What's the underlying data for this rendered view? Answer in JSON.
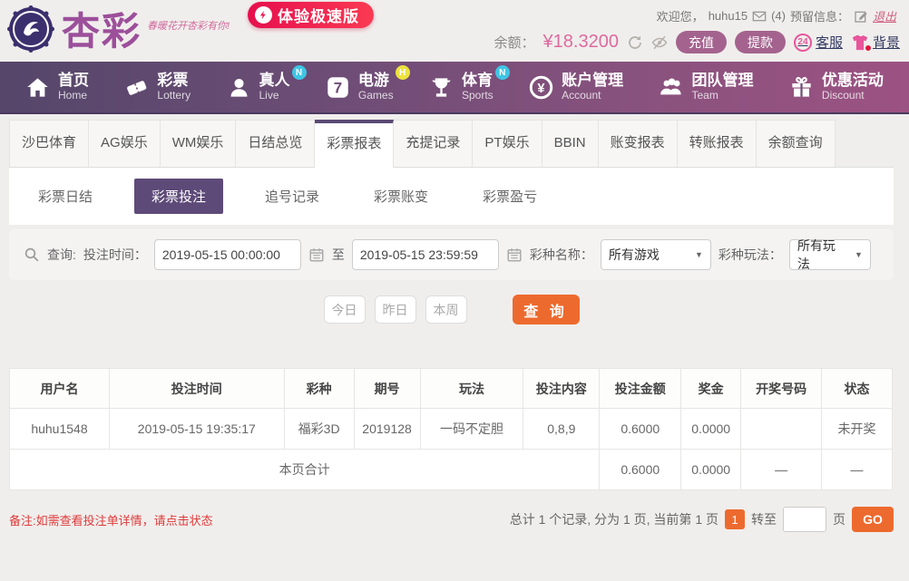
{
  "colors": {
    "accent_purple": "#5b4a73",
    "accent_orange": "#ed6a2e",
    "balance_pink": "#dd6a9f",
    "status_green": "#3c9e40",
    "note_red": "#e03a3a",
    "nav_badge_cyan": "#3fc6e4",
    "nav_badge_yellow": "#ede23e"
  },
  "header": {
    "brand": {
      "name": "杏彩",
      "tagline": "春暖花开杏彩有你!",
      "speed_badge": "体验极速版"
    },
    "welcome": {
      "greeting": "欢迎您，",
      "username": "huhu15",
      "mail_count": "(4)",
      "reserved_label": "预留信息：",
      "logout": "退出"
    },
    "balance": {
      "label": "余额：",
      "amount": "¥18.3200",
      "recharge": "充值",
      "withdraw": "提款",
      "service_badge": "24",
      "service": "客服",
      "background": "背景"
    }
  },
  "nav": {
    "items": [
      {
        "zh": "首页",
        "en": "Home",
        "badge": ""
      },
      {
        "zh": "彩票",
        "en": "Lottery",
        "badge": ""
      },
      {
        "zh": "真人",
        "en": "Live",
        "badge": "N"
      },
      {
        "zh": "电游",
        "en": "Games",
        "badge": "H"
      },
      {
        "zh": "体育",
        "en": "Sports",
        "badge": "N"
      },
      {
        "zh": "账户管理",
        "en": "Account",
        "badge": ""
      },
      {
        "zh": "团队管理",
        "en": "Team",
        "badge": ""
      },
      {
        "zh": "优惠活动",
        "en": "Discount",
        "badge": ""
      }
    ]
  },
  "tabs": {
    "active_index": 4,
    "items": [
      {
        "label": "沙巴体育"
      },
      {
        "label": "AG娱乐"
      },
      {
        "label": "WM娱乐"
      },
      {
        "label": "日结总览"
      },
      {
        "label": "彩票报表"
      },
      {
        "label": "充提记录"
      },
      {
        "label": "PT娱乐"
      },
      {
        "label": "BBIN"
      },
      {
        "label": "账变报表"
      },
      {
        "label": "转账报表"
      },
      {
        "label": "余额查询"
      }
    ]
  },
  "subtabs": {
    "active_index": 1,
    "items": [
      {
        "label": "彩票日结"
      },
      {
        "label": "彩票投注"
      },
      {
        "label": "追号记录"
      },
      {
        "label": "彩票账变"
      },
      {
        "label": "彩票盈亏"
      }
    ]
  },
  "search": {
    "query_label": "查询:",
    "time_label": "投注时间：",
    "from_value": "2019-05-15 00:00:00",
    "to_label": "至",
    "to_value": "2019-05-15 23:59:59",
    "game_label": "彩种名称：",
    "game_value": "所有游戏",
    "play_label": "彩种玩法：",
    "play_value": "所有玩法",
    "caret": "▼"
  },
  "quick": {
    "today": "今日",
    "yesterday": "昨日",
    "week": "本周",
    "search_button": "查 询"
  },
  "table": {
    "headers": [
      "用户名",
      "投注时间",
      "彩种",
      "期号",
      "玩法",
      "投注内容",
      "投注金额",
      "奖金",
      "开奖号码",
      "状态"
    ],
    "rows": [
      {
        "cells": [
          "huhu1548",
          "2019-05-15 19:35:17",
          "福彩3D",
          "2019128",
          "一码不定胆",
          "0,8,9",
          "0.6000",
          "0.0000",
          "",
          "未开奖"
        ]
      }
    ],
    "summary": {
      "label": "本页合计",
      "bet_total": "0.6000",
      "prize_total": "0.0000",
      "draw_dash": "—",
      "status_dash": "—"
    }
  },
  "footer": {
    "note": "备注:如需查看投注单详情，请点击状态",
    "pagination": {
      "summary": "总计 1 个记录, 分为 1 页, 当前第 1 页",
      "current_page": "1",
      "goto_label": "转至",
      "page_label": "页",
      "go_button": "GO"
    }
  }
}
